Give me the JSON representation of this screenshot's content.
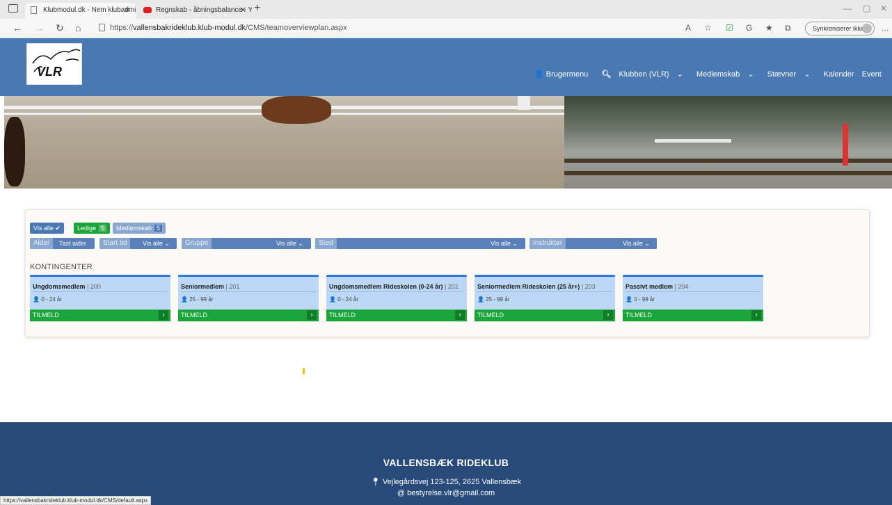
{
  "browser": {
    "tabs": [
      {
        "title": "Klubmodul.dk - Nem klubadmin"
      },
      {
        "title": "Regnskab - åbningsbalance - Yo"
      }
    ],
    "address_prefix": "https://",
    "address_host": "vallensbakrideklub.klub-modul.dk",
    "address_path": "/CMS/teamoverviewplan.aspx",
    "sync_label": "Synkroniserer ikke",
    "status_url": "https://vallensbakrideklub.klub-modul.dk/CMS/default.aspx"
  },
  "header": {
    "logo_text": "VLR",
    "nav": [
      {
        "label": "Brugermenu"
      },
      {
        "label": "Klubben (VLR)"
      },
      {
        "label": "Medlemskab"
      },
      {
        "label": "Stævner"
      },
      {
        "label": "Kalender"
      },
      {
        "label": "Event"
      }
    ]
  },
  "filters": {
    "vis_alle": "Vis alle",
    "ledige": "Ledige",
    "ledige_count": "5",
    "medlemskab": "Medlemskab",
    "medlemskab_count": "5",
    "alder_label": "Alder",
    "alder_value": "Tast alder",
    "start_label": "Start tid",
    "start_value": "Vis alle",
    "gruppe_label": "Gruppe",
    "gruppe_value": "Vis alle",
    "sted_label": "Sted",
    "sted_value": "Vis alle",
    "instruktor_label": "Instruktør",
    "instruktor_value": "Vis alle"
  },
  "section_title": "KONTINGENTER",
  "cards": [
    {
      "name": "Ungdomsmedlem",
      "num": "200",
      "age": "0 - 24 år",
      "signup": "TILMELD"
    },
    {
      "name": "Seniormedlem",
      "num": "201",
      "age": "25 - 99 år",
      "signup": "TILMELD"
    },
    {
      "name": "Ungdomsmedlem Rideskolen (0-24 år)",
      "num": "202",
      "age": "0 - 24 år",
      "signup": "TILMELD"
    },
    {
      "name": "Seniormedlem Rideskolen (25 år+)",
      "num": "203",
      "age": "25 - 99 år",
      "signup": "TILMELD"
    },
    {
      "name": "Passivt medlem",
      "num": "204",
      "age": "0 - 99 år",
      "signup": "TILMELD"
    }
  ],
  "footer": {
    "club_name": "VALLENSBÆK RIDEKLUB",
    "address": "Vejlegårdsvej 123-125, 2625 Vallensbæk",
    "email": "bestyrelse.vlr@gmail.com"
  },
  "colors": {
    "header_blue": "#4a78b2",
    "footer_blue": "#274a7a",
    "signup_green": "#1aa43a",
    "card_bg": "#bcd8f4"
  }
}
